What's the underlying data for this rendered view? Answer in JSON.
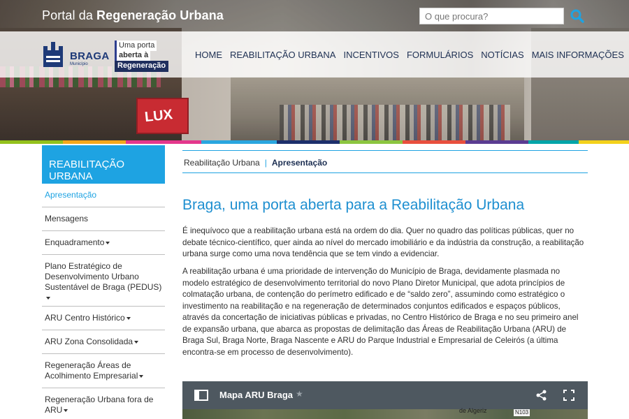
{
  "header": {
    "portal_prefix": "Portal da ",
    "portal_bold": "Regeneração Urbana",
    "search_placeholder": "O que procura?",
    "logo_text": "BRAGA",
    "logo_sub": "Município",
    "badge": {
      "line1": "Uma porta",
      "line2": "aberta à",
      "line3": "Regeneração"
    },
    "hero_sign": "LUX",
    "nav": [
      "HOME",
      "REABILITAÇÃO URBANA",
      "INCENTIVOS",
      "FORMULÁRIOS",
      "NOTÍCIAS",
      "MAIS INFORMAÇÕES"
    ]
  },
  "sidebar": {
    "heading": "REABILITAÇÃO URBANA",
    "items": [
      {
        "label": "Apresentação"
      },
      {
        "label": "Mensagens"
      },
      {
        "label": "Enquadramento"
      },
      {
        "label": "Plano Estratégico de Desenvolvimento Urbano Sustentável de Braga (PEDUS)"
      },
      {
        "label": "ARU Centro Histórico"
      },
      {
        "label": "ARU Zona Consolidada"
      },
      {
        "label": "Regeneração Áreas de Acolhimento Empresarial"
      },
      {
        "label": "Regeneração Urbana fora de ARU"
      }
    ]
  },
  "breadcrumb": {
    "parent": "Reabilitação Urbana",
    "separator": "|",
    "current": "Apresentação"
  },
  "main": {
    "title": "Braga, uma porta aberta para a Reabilitação Urbana",
    "paragraph1": "É inequívoco que a reabilitação urbana está na ordem do dia. Quer no quadro das políticas públicas, quer no debate técnico-científico, quer ainda ao nível do mercado imobiliário e da indústria da construção, a reabilitação urbana surge como uma nova tendência que se tem vindo a evidenciar.",
    "paragraph2": "A reabilitação urbana é uma prioridade de intervenção do Município de Braga, devidamente plasmada no modelo estratégico de desenvolvimento territorial do novo Plano Diretor Municipal, que adota princípios de colmatação urbana, de contenção do perímetro edificado e de “saldo zero”, assumindo como estratégico o investimento na reabilitação e na regeneração de determinados conjuntos edificados e espaços públicos, através da concertação de iniciativas públicas e privadas, no Centro Histórico de Braga e no seu primeiro anel de expansão urbana, que abarca as propostas de delimitação das Áreas de Reabilitação Urbana (ARU) de Braga Sul, Braga Norte, Braga Nascente e ARU do Parque Industrial e Empresarial de Celeirós (a última encontra-se em processo de desenvolvimento)."
  },
  "map": {
    "title": "Mapa ARU Braga",
    "label_place": "de Algeriz",
    "label_road": "N103"
  },
  "colors": {
    "accent": "#1ea3e2",
    "title_blue": "#1e8fd0",
    "nav_text": "#1d2f52",
    "map_bar": "#4e5860"
  }
}
